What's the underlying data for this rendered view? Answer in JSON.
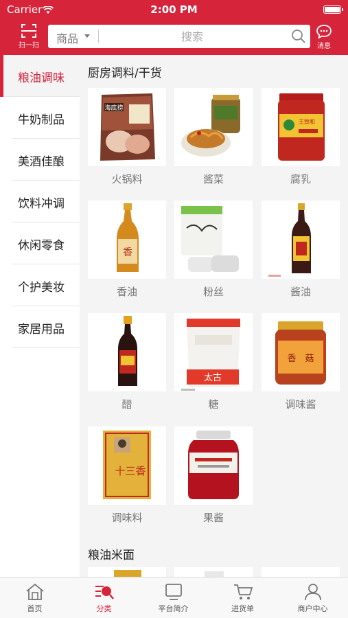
{
  "status_bar": {
    "carrier": "Carrier",
    "time": "2:00 PM"
  },
  "header": {
    "scan_label": "扫一扫",
    "search_category": "商品",
    "search_placeholder": "搜索",
    "message_label": "消息"
  },
  "sidebar": {
    "items": [
      {
        "label": "粮油调味",
        "active": true
      },
      {
        "label": "牛奶制品",
        "active": false
      },
      {
        "label": "美酒佳酿",
        "active": false
      },
      {
        "label": "饮料冲调",
        "active": false
      },
      {
        "label": "休闲零食",
        "active": false
      },
      {
        "label": "个护美妆",
        "active": false
      },
      {
        "label": "家居用品",
        "active": false
      }
    ]
  },
  "sections": [
    {
      "title": "厨房调料/干货",
      "products": [
        "火锅料",
        "酱菜",
        "腐乳",
        "香油",
        "粉丝",
        "酱油",
        "醋",
        "糖",
        "调味酱",
        "调味料",
        "果酱"
      ]
    },
    {
      "title": "粮油米面",
      "products": []
    }
  ],
  "product_image_text": {
    "hotpot": "海底捞",
    "tofu": "王致和",
    "sugar": "太古",
    "spice": "十三香"
  },
  "tabbar": {
    "items": [
      {
        "label": "首页",
        "active": false
      },
      {
        "label": "分类",
        "active": true
      },
      {
        "label": "平台简介",
        "active": false
      },
      {
        "label": "进货单",
        "active": false
      },
      {
        "label": "商户中心",
        "active": false
      }
    ]
  },
  "colors": {
    "brand": "#d6243b",
    "background": "#f4f4f4",
    "text_muted": "#777777"
  }
}
